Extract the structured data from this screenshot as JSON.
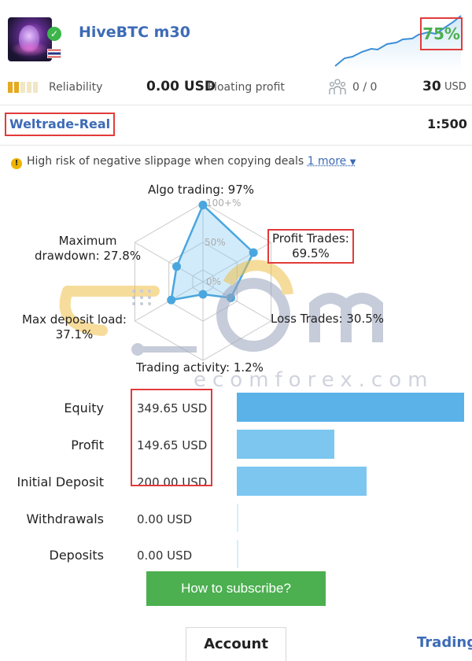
{
  "header": {
    "title": "HiveBTC m30",
    "growth": "75%",
    "avatar_icon": "avatar-image",
    "verified_icon": "check-icon",
    "flag_icon": "thailand-flag-icon"
  },
  "stats": {
    "reliability_label": "Reliability",
    "reliability_level": 0.4,
    "floating_value": "0.00 USD",
    "floating_label": "Floating profit",
    "subscribers": "0 / 0",
    "price_value": "30",
    "price_currency": "USD"
  },
  "account": {
    "broker": "Weltrade-Real",
    "leverage": "1:500"
  },
  "warning": {
    "text": "High risk of negative slippage when copying deals",
    "more": "1 more"
  },
  "radar": {
    "axis_100": "100+%",
    "axis_50": "50%",
    "axis_0": "0%",
    "algo": "Algo trading: 97%",
    "profit_trades_l1": "Profit Trades:",
    "profit_trades_l2": "69.5%",
    "loss_trades": "Loss Trades: 30.5%",
    "activity": "Trading activity: 1.2%",
    "deposit_load_l1": "Max deposit load:",
    "deposit_load_l2": "37.1%",
    "drawdown_l1": "Maximum",
    "drawdown_l2": "drawdown: 27.8%",
    "values": [
      97,
      69.5,
      30.5,
      1.2,
      37.1,
      27.8
    ]
  },
  "watermark": {
    "text": "ecomforex.com"
  },
  "metrics": [
    {
      "label": "Equity",
      "value": "349.65 USD",
      "amount": 349.65
    },
    {
      "label": "Profit",
      "value": "149.65 USD",
      "amount": 149.65
    },
    {
      "label": "Initial Deposit",
      "value": "200.00 USD",
      "amount": 200.0
    },
    {
      "label": "Withdrawals",
      "value": "0.00 USD",
      "amount": 0
    },
    {
      "label": "Deposits",
      "value": "0.00 USD",
      "amount": 0
    }
  ],
  "actions": {
    "subscribe": "How to subscribe?"
  },
  "tabs": {
    "account": "Account",
    "trading": "Trading"
  },
  "colors": {
    "brand_blue": "#3d6bb6",
    "green": "#4caf50",
    "bar_blue": "#7cc6f0",
    "highlight_red": "#e23b3b"
  }
}
